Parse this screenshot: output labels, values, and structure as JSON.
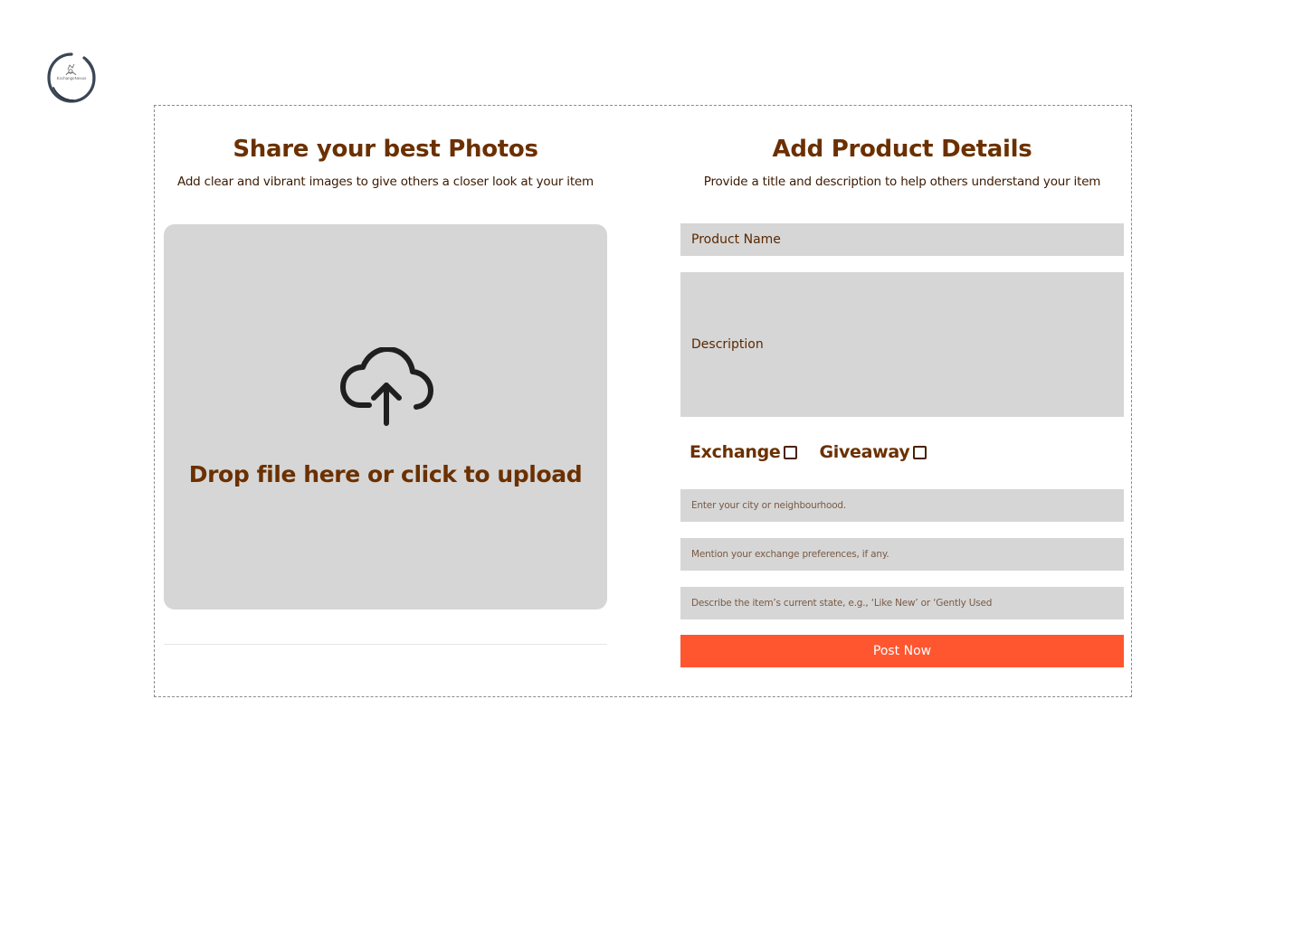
{
  "brand": {
    "logo_text": "ExchangeNexus"
  },
  "photos": {
    "title": "Share your best Photos",
    "subtitle": "Add clear and vibrant images to give others a closer look at your item",
    "upload_icon": "cloud-upload-icon",
    "upload_text": "Drop file here or click to upload"
  },
  "details": {
    "title": "Add Product Details",
    "subtitle": "Provide a title and description to help others understand your item",
    "product_name_placeholder": "Product Name",
    "description_placeholder": "Description",
    "exchange_label": "Exchange",
    "exchange_checked": false,
    "giveaway_label": "Giveaway",
    "giveaway_checked": false,
    "location_placeholder": "Enter your city or neighbourhood.",
    "preferences_placeholder": "Mention your exchange preferences, if any.",
    "condition_placeholder": "Describe the item’s current state, e.g., ‘Like New’ or ‘Gently Used",
    "post_button": "Post Now"
  },
  "colors": {
    "accent": "#ff5630",
    "heading": "#6b3000",
    "field_bg": "#d6d6d6"
  }
}
